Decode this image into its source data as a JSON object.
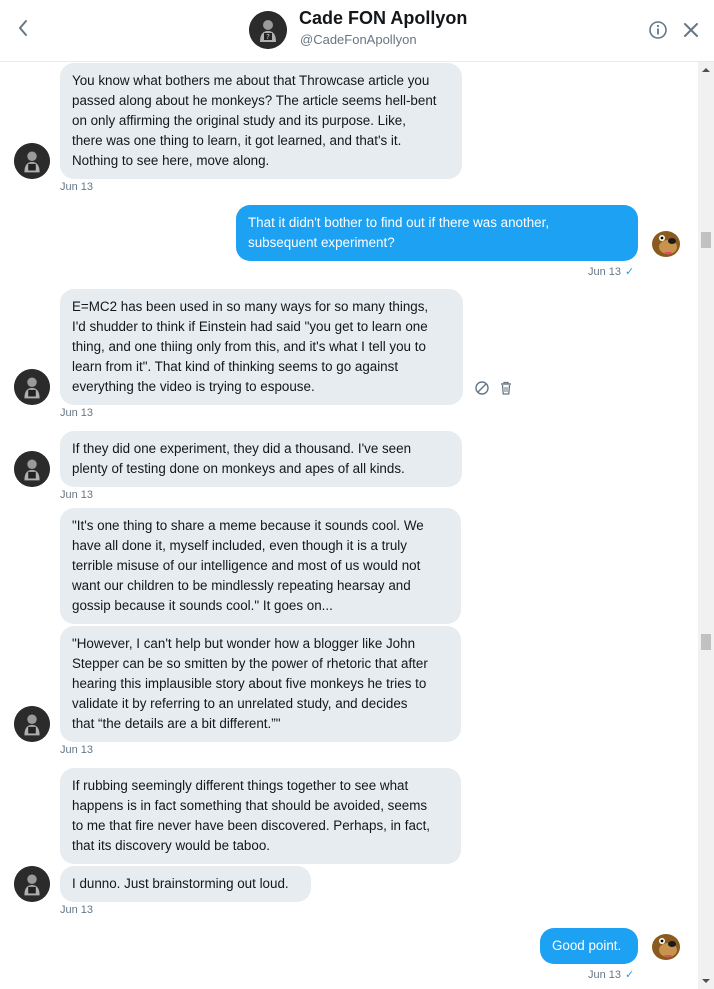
{
  "header": {
    "name": "Cade FON Apollyon",
    "handle": "@CadeFonApollyon"
  },
  "messages": [
    {
      "direction": "in",
      "lines": [
        "You know what bothers me about that Throwcase article you",
        "passed along about he monkeys? The article seems hell-bent",
        "on only affirming the original study and its purpose. Like,",
        "there was one thing to learn, it got learned, and that's it.",
        "Nothing to see here, move along."
      ],
      "timestamp": "Jun 13"
    },
    {
      "direction": "out",
      "lines": [
        "That it didn't bother to find out if there was another,",
        "subsequent experiment?"
      ],
      "timestamp": "Jun 13"
    },
    {
      "direction": "in",
      "lines": [
        "E=MC2 has been used in so many ways for so many things,",
        "I'd shudder to think if Einstein had said \"you get to learn one",
        "thing, and one thiing only from this, and it's what I tell you to",
        "learn from it\". That kind of thinking seems to go against",
        "everything the video is trying to espouse."
      ],
      "timestamp": "Jun 13"
    },
    {
      "direction": "in",
      "lines": [
        "If they did one experiment, they did a thousand. I've seen",
        "plenty of testing done on monkeys and apes of all kinds."
      ],
      "timestamp": "Jun 13"
    },
    {
      "direction": "in",
      "lines": [
        "\"It's one thing to share a meme because it sounds cool. We",
        "have all done it, myself included, even though it is a truly",
        "terrible misuse of our intelligence and most of us would not",
        "want our children to be mindlessly repeating hearsay and",
        "gossip because it sounds cool.\" It goes on..."
      ]
    },
    {
      "direction": "in",
      "lines": [
        "\"However, I can't help but wonder how a blogger like John",
        "Stepper can be so smitten by the power of rhetoric that after",
        "hearing this implausible story about five monkeys he tries to",
        "validate it by referring to an unrelated study, and decides",
        "that “the details are a bit different.”\""
      ],
      "timestamp": "Jun 13"
    },
    {
      "direction": "in",
      "lines": [
        "If rubbing seemingly different things together to see what",
        "happens is in fact something that should be avoided, seems",
        "to me that fire never have been discovered. Perhaps, in fact,",
        "that its discovery would be taboo."
      ]
    },
    {
      "direction": "in",
      "lines": [
        "I dunno. Just brainstorming out loud."
      ],
      "timestamp": "Jun 13"
    },
    {
      "direction": "out",
      "lines": [
        "Good point."
      ],
      "timestamp": "Jun 13"
    }
  ],
  "icons": {
    "back": "chevron-left-icon",
    "info": "info-icon",
    "close": "close-icon",
    "report": "block-icon",
    "delete": "trash-icon",
    "read": "checkmark-icon"
  },
  "colors": {
    "accent": "#1da1f2",
    "incoming_bubble": "#e6ecf0",
    "muted_text": "#657786"
  }
}
